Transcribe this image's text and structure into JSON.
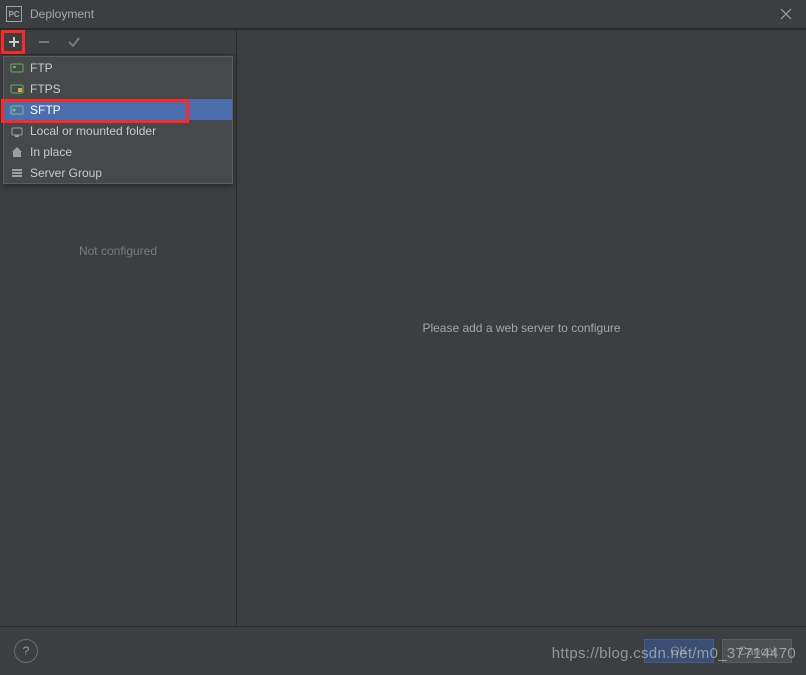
{
  "title": "Deployment",
  "app_icon_text": "PC",
  "toolbar": {
    "add_tooltip": "Add",
    "remove_tooltip": "Remove",
    "check_tooltip": "Set as default"
  },
  "dropdown": {
    "items": [
      {
        "label": "FTP",
        "icon": "ftp-icon",
        "selected": false
      },
      {
        "label": "FTPS",
        "icon": "ftps-icon",
        "selected": false
      },
      {
        "label": "SFTP",
        "icon": "sftp-icon",
        "selected": true
      },
      {
        "label": "Local or mounted folder",
        "icon": "local-folder-icon",
        "selected": false
      },
      {
        "label": "In place",
        "icon": "home-icon",
        "selected": false
      },
      {
        "label": "Server Group",
        "icon": "server-group-icon",
        "selected": false
      }
    ]
  },
  "sidebar": {
    "placeholder": "Not configured"
  },
  "main": {
    "placeholder": "Please add a web server to configure"
  },
  "footer": {
    "help": "?",
    "ok": "OK",
    "cancel": "Cancel"
  },
  "watermark": "https://blog.csdn.net/m0_37714470"
}
